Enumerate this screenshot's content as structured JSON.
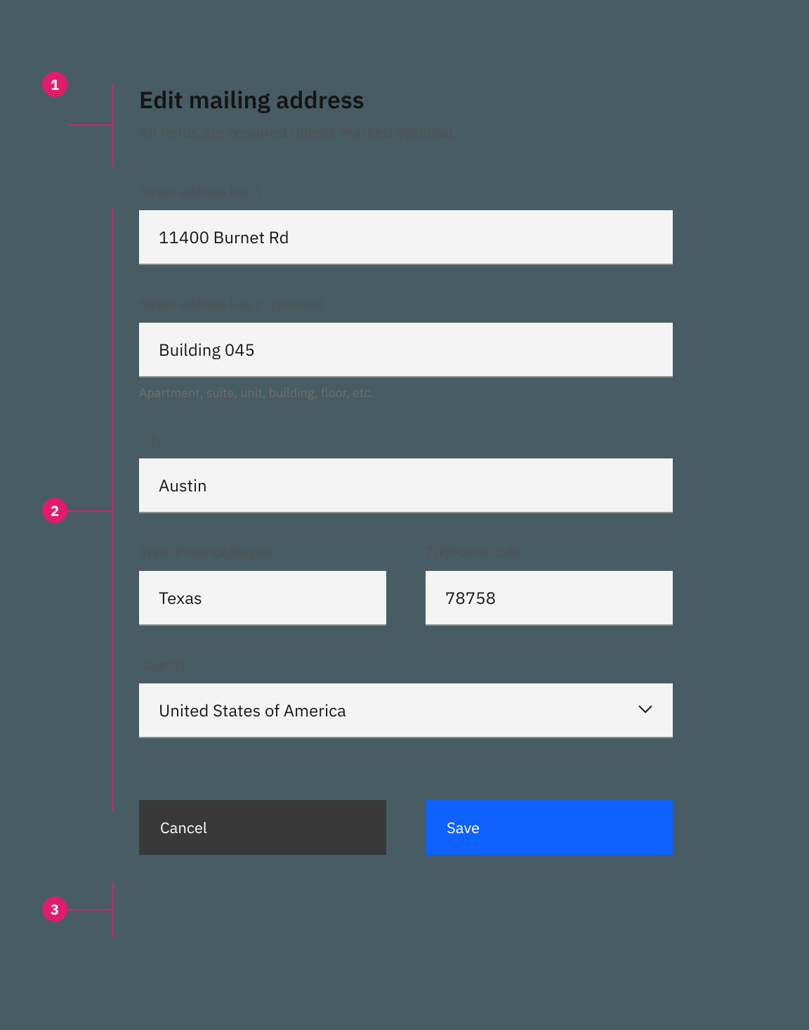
{
  "annotations": {
    "a1": "1",
    "a2": "2",
    "a3": "3"
  },
  "header": {
    "title": "Edit mailing address",
    "required_note": "All fields are required unless marked optional."
  },
  "fields": {
    "street1": {
      "label": "Street address line 1",
      "value": "11400 Burnet Rd"
    },
    "street2": {
      "label": "Street address line 2 (optional)",
      "value": "Building 045",
      "helper": "Apartment, suite, unit, building, floor, etc."
    },
    "city": {
      "label": "City",
      "value": "Austin"
    },
    "state": {
      "label": "State/Province/Region",
      "value": "Texas"
    },
    "zip": {
      "label": "ZIP/Postal code",
      "value": "78758"
    },
    "country": {
      "label": "Country",
      "value": "United States of America"
    }
  },
  "buttons": {
    "cancel": "Cancel",
    "save": "Save"
  }
}
